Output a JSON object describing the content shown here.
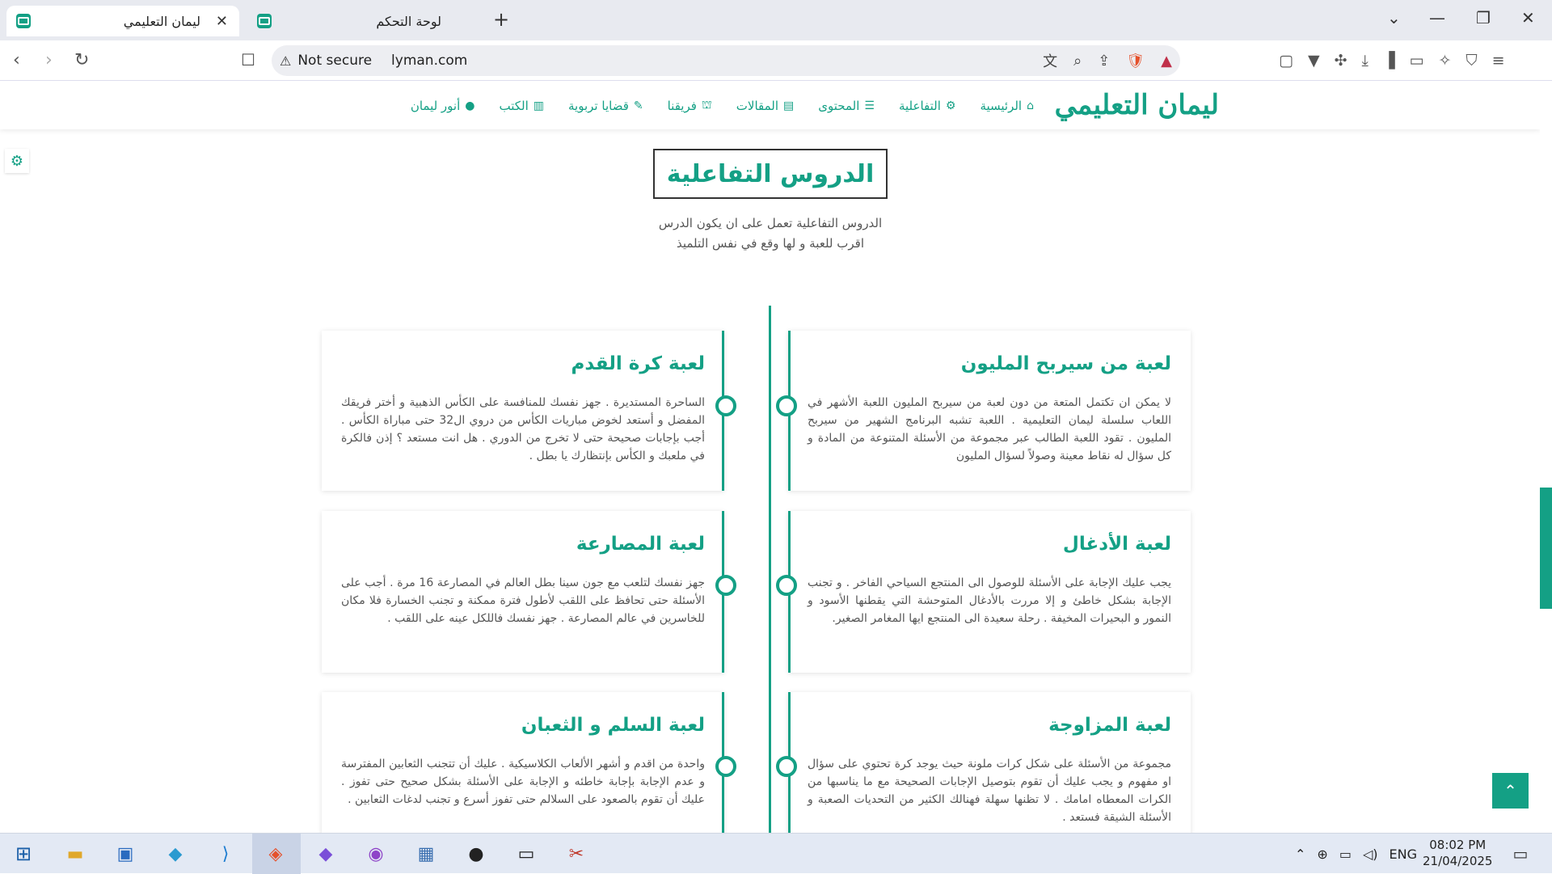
{
  "browser": {
    "tabs": [
      {
        "title": "ليمان التعليمي",
        "active": true
      },
      {
        "title": "لوحة التحكم",
        "active": false
      }
    ],
    "new_tab": "+",
    "address": {
      "security": "Not secure",
      "url": "lyman.com"
    },
    "icons": {
      "back": "‹",
      "forward": "›",
      "reload": "↻",
      "bookmark": "☐"
    }
  },
  "site": {
    "logo": "ليمان التعليمي",
    "menu": [
      {
        "label": "الرئيسية",
        "icon": "home-icon"
      },
      {
        "label": "التفاعلية",
        "icon": "cog-icon"
      },
      {
        "label": "المحتوى",
        "icon": "list-icon"
      },
      {
        "label": "المقالات",
        "icon": "newspaper-icon"
      },
      {
        "label": "فريقنا",
        "icon": "team-icon"
      },
      {
        "label": "قضايا تربوية",
        "icon": "pen-icon"
      },
      {
        "label": "الكتب",
        "icon": "book-icon"
      },
      {
        "label": "أنور ليمان",
        "icon": "user-icon"
      }
    ],
    "section_title": "الدروس التفاعلية",
    "section_subtitle_1": "الدروس التفاعلية تعمل على ان يكون الدرس",
    "section_subtitle_2": "اقرب للعبة و لها وقع في نفس التلميذ",
    "cards": [
      {
        "title": "لعبة من سيربح المليون",
        "text": "لا يمكن ان تكتمل المتعة من دون لعبة من سيربح المليون اللعبة الأشهر في اللعاب سلسلة ليمان التعليمية . اللعبة تشبه البرنامج الشهير من سيربح المليون . تقود اللعبة الطالب عبر مجموعة من الأسئلة المتنوعة من المادة و كل سؤال له نقاط معينة وصولاً لسؤال المليون"
      },
      {
        "title": "لعبة كرة القدم",
        "text": "الساحرة المستديرة . جهز نفسك للمنافسة على الكأس الذهبية و أختر فريقك المفضل و أستعد لخوض مباريات الكأس من دروي ال32 حتى مباراة الكأس . أجب بإجابات صحيحة حتى لا تخرج من الدوري . هل انت مستعد ؟ إذن فالكرة في ملعبك و الكأس بإنتظارك يا بطل ."
      },
      {
        "title": "لعبة الأدغال",
        "text": "يجب عليك الإجابة على الأسئلة للوصول الى المنتجع السياحي الفاخر . و تجنب الإجابة بشكل خاطئ و إلا مررت بالأدغال المتوحشة التي يقطنها الأسود و النمور و البحيرات المخيفة . رحلة سعيدة الى المنتجع ايها المغامر الصغير."
      },
      {
        "title": "لعبة المصارعة",
        "text": "جهز نفسك لتلعب مع جون سينا بطل العالم في المصارعة 16 مرة . أجب على الأسئلة حتى تحافظ على اللقب لأطول فترة ممكنة و تجنب الخسارة فلا مكان للخاسرين في عالم المصارعة . جهز نفسك فاللكل عينه على اللقب ."
      },
      {
        "title": "لعبة المزاوجة",
        "text": "مجموعة من الأسئلة على شكل كرات ملونة حيث يوجد كرة تحتوي على سؤال او مفهوم و يجب عليك أن تقوم بتوصيل الإجابات الصحيحة مع ما يناسبها من الكرات المعطاه امامك . لا تظنها سهلة فهنالك الكثير من التحديات الصعبة و الأسئلة الشيقة فستعد ."
      },
      {
        "title": "لعبة السلم و الثعبان",
        "text": "واحدة من اقدم و أشهر الألعاب الكلاسيكية . عليك أن تتجنب الثعابين المفترسة و عدم الإجابة بإجابة خاطئه و الإجابة على الأسئلة بشكل صحيح حتى تفوز . عليك أن تقوم بالصعود على السلالم حتى تفوز أسرع و تجنب لدغات الثعابين ."
      }
    ]
  },
  "taskbar": {
    "lang": "ENG",
    "time": "08:02 PM",
    "date": "21/04/2025"
  },
  "colors": {
    "accent": "#14a085"
  }
}
